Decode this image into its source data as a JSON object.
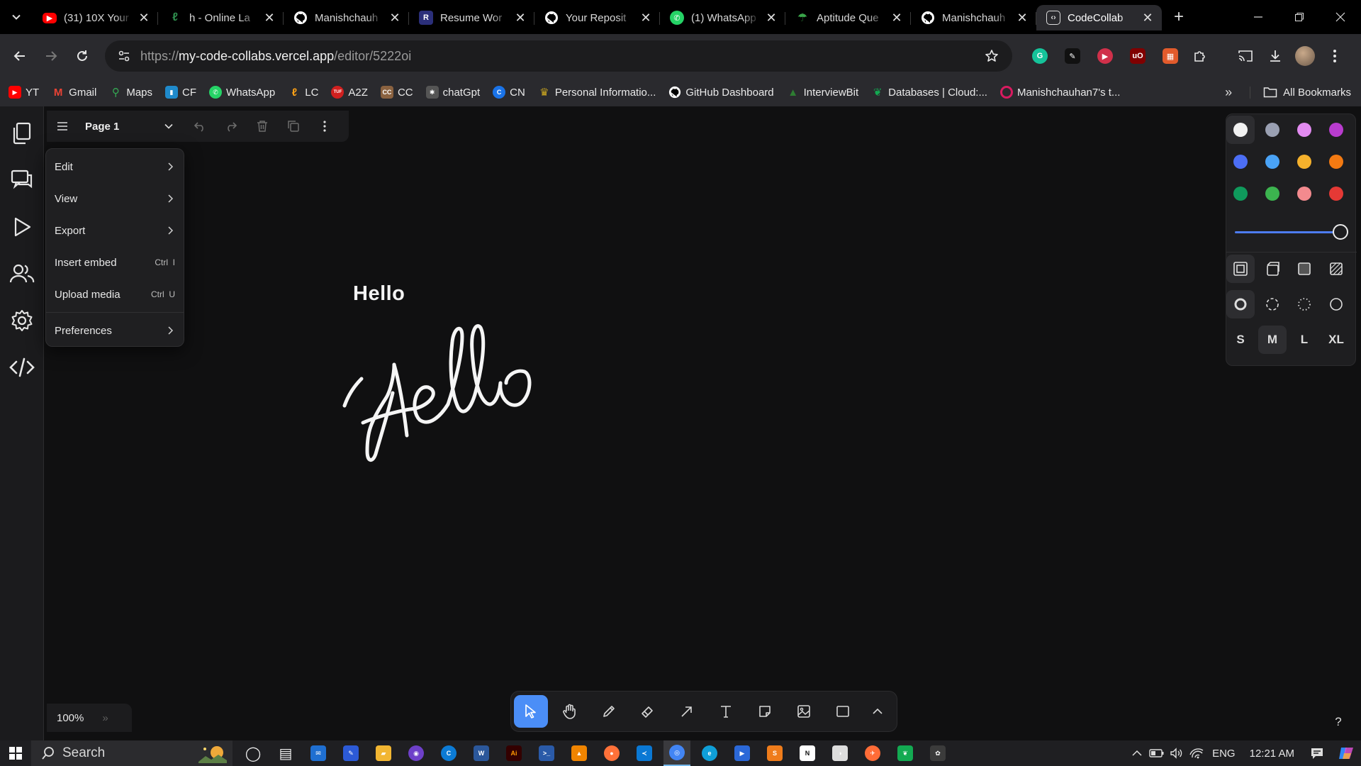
{
  "browser": {
    "tabs": [
      {
        "title": "(31) 10X Your",
        "icon": "youtube-icon",
        "color": "#ff0000",
        "glyph": "▶",
        "active": false
      },
      {
        "title": "h - Online La",
        "icon": "leetcode-icon",
        "color": "#2f8f4e",
        "glyph": "ℓ",
        "active": false
      },
      {
        "title": "Manishchauh",
        "icon": "github-icon",
        "color": "#ffffff",
        "glyph": "",
        "active": false
      },
      {
        "title": "Resume Wor",
        "icon": "resume-worded-icon",
        "color": "#2b2f7a",
        "glyph": "R",
        "active": false
      },
      {
        "title": "Your Reposit",
        "icon": "github-icon",
        "color": "#ffffff",
        "glyph": "",
        "active": false
      },
      {
        "title": "(1) WhatsApp",
        "icon": "whatsapp-icon",
        "color": "#25d366",
        "glyph": "✆",
        "active": false
      },
      {
        "title": "Aptitude Que",
        "icon": "indiabix-icon",
        "color": "#3aa64a",
        "glyph": "☂",
        "active": false
      },
      {
        "title": "Manishchauh",
        "icon": "github-icon",
        "color": "#ffffff",
        "glyph": "",
        "active": false
      },
      {
        "title": "CodeCollab",
        "icon": "codecollab-icon",
        "color": "#2a2a2e",
        "glyph": "‹›",
        "active": true
      }
    ],
    "url_prefix": "https://",
    "url_host": "my-code-collabs.vercel.app",
    "url_path": "/editor/5222oi",
    "bookmarks": [
      {
        "label": "YT",
        "icon": "youtube-icon",
        "color": "#ff0000",
        "glyph": "▶"
      },
      {
        "label": "Gmail",
        "icon": "gmail-icon",
        "color": "#ea4335",
        "glyph": "M"
      },
      {
        "label": "Maps",
        "icon": "maps-icon",
        "color": "#34a853",
        "glyph": "⚲"
      },
      {
        "label": "CF",
        "icon": "codeforces-icon",
        "color": "#1f8acb",
        "glyph": "▮"
      },
      {
        "label": "WhatsApp",
        "icon": "whatsapp-icon",
        "color": "#25d366",
        "glyph": "✆"
      },
      {
        "label": "LC",
        "icon": "leetcode-icon",
        "color": "#ffa116",
        "glyph": "ℓ"
      },
      {
        "label": "A2Z",
        "icon": "tuf-icon",
        "color": "#d0201f",
        "glyph": "TUF"
      },
      {
        "label": "CC",
        "icon": "codechef-icon",
        "color": "#8a6240",
        "glyph": "CC"
      },
      {
        "label": "chatGpt",
        "icon": "chatgpt-icon",
        "color": "#555",
        "glyph": "✱"
      },
      {
        "label": "CN",
        "icon": "codingninjas-icon",
        "color": "#1a73e8",
        "glyph": "C"
      },
      {
        "label": "Personal Informatio...",
        "icon": "crown-icon",
        "color": "#caa620",
        "glyph": "♛"
      },
      {
        "label": "GitHub Dashboard",
        "icon": "github-icon",
        "color": "#ffffff",
        "glyph": ""
      },
      {
        "label": "InterviewBit",
        "icon": "interviewbit-icon",
        "color": "#2e7d32",
        "glyph": "▲"
      },
      {
        "label": "Databases | Cloud:...",
        "icon": "mongodb-icon",
        "color": "#13aa52",
        "glyph": "❦"
      },
      {
        "label": "Manishchauhan7's t...",
        "icon": "profile-ring-icon",
        "color": "#d81b60",
        "glyph": "◯"
      }
    ],
    "all_bookmarks": "All Bookmarks",
    "extensions": [
      {
        "name": "grammarly-icon",
        "color": "#15c39a",
        "glyph": "G"
      },
      {
        "name": "notes-ext-icon",
        "color": "#111",
        "glyph": "✎"
      },
      {
        "name": "recorder-ext-icon",
        "color": "#d0304a",
        "glyph": "▶"
      },
      {
        "name": "ublock-icon",
        "color": "#800000",
        "glyph": "uO"
      },
      {
        "name": "color-ext-icon",
        "color": "#e25b2c",
        "glyph": "▦"
      }
    ]
  },
  "app": {
    "page_name": "Page 1",
    "menu": {
      "items": [
        {
          "label": "Edit",
          "shortcut": "",
          "submenu": true
        },
        {
          "label": "View",
          "shortcut": "",
          "submenu": true
        },
        {
          "label": "Export",
          "shortcut": "",
          "submenu": true
        },
        {
          "label": "Insert embed",
          "shortcut": "Ctrl  I",
          "submenu": false
        },
        {
          "label": "Upload media",
          "shortcut": "Ctrl  U",
          "submenu": false
        },
        {
          "label": "Preferences",
          "shortcut": "",
          "submenu": true
        }
      ]
    },
    "canvas_text": "Hello",
    "zoom": "100%",
    "style_panel": {
      "colors": [
        "#f2f2f2",
        "#9aa0b2",
        "#e28bf0",
        "#b93ccf",
        "#4c6ef5",
        "#4aa3f6",
        "#f5b12c",
        "#f37a12",
        "#0f9a5c",
        "#3cb44f",
        "#f38a8e",
        "#e53935"
      ],
      "selected_color": 0,
      "opacity": 1.0,
      "fill_styles": [
        "fill-none-icon",
        "fill-semi-icon",
        "fill-solid-icon",
        "fill-pattern-icon"
      ],
      "dash_styles": [
        "dash-draw-icon",
        "dash-dashed-icon",
        "dash-dotted-icon",
        "dash-solid-icon"
      ],
      "sizes": [
        "S",
        "M",
        "L",
        "XL"
      ],
      "selected_size": "M"
    },
    "tools": [
      "select-tool",
      "hand-tool",
      "draw-tool",
      "eraser-tool",
      "arrow-tool",
      "text-tool",
      "note-tool",
      "media-tool",
      "rectangle-tool",
      "more-tools"
    ],
    "help": "?"
  },
  "taskbar": {
    "search_placeholder": "Search",
    "apps": [
      {
        "name": "task-view-icon",
        "color": "#1f1f22",
        "glyph": "◯"
      },
      {
        "name": "widgets-icon",
        "color": "#1f1f22",
        "glyph": "▤"
      },
      {
        "name": "mail-icon",
        "color": "#1f6fd1",
        "glyph": "✉"
      },
      {
        "name": "pen-app-icon",
        "color": "#2c5ad6",
        "glyph": "✎"
      },
      {
        "name": "file-explorer-icon",
        "color": "#f2b632",
        "glyph": "▰"
      },
      {
        "name": "github-desktop-icon",
        "color": "#6e40c9",
        "glyph": "◉"
      },
      {
        "name": "edge-dev-icon",
        "color": "#0c7bd5",
        "glyph": "C"
      },
      {
        "name": "word-icon",
        "color": "#2b579a",
        "glyph": "W"
      },
      {
        "name": "illustrator-icon",
        "color": "#330000",
        "glyph": "Ai"
      },
      {
        "name": "powershell-icon",
        "color": "#2a5aa8",
        "glyph": ">_"
      },
      {
        "name": "vlc-icon",
        "color": "#f08400",
        "glyph": "▲"
      },
      {
        "name": "firefox-icon",
        "color": "#ff7139",
        "glyph": "●"
      },
      {
        "name": "vscode-icon",
        "color": "#0a78d4",
        "glyph": "≺"
      },
      {
        "name": "chrome-icon",
        "color": "#4285f4",
        "glyph": "◎",
        "active": true
      },
      {
        "name": "edge-icon",
        "color": "#0f9fd8",
        "glyph": "e"
      },
      {
        "name": "photos-icon",
        "color": "#2b68d8",
        "glyph": "▶"
      },
      {
        "name": "sublime-icon",
        "color": "#ef7c1b",
        "glyph": "S"
      },
      {
        "name": "notion-icon",
        "color": "#ffffff",
        "glyph": "N"
      },
      {
        "name": "github-app-icon",
        "color": "#ddd",
        "glyph": "◑"
      },
      {
        "name": "postman-icon",
        "color": "#ff6c37",
        "glyph": "✈"
      },
      {
        "name": "mongodb-compass-icon",
        "color": "#13aa52",
        "glyph": "❦"
      },
      {
        "name": "davinci-icon",
        "color": "#3b3b3b",
        "glyph": "✿"
      }
    ],
    "lang": "ENG",
    "time": "12:21 AM"
  }
}
